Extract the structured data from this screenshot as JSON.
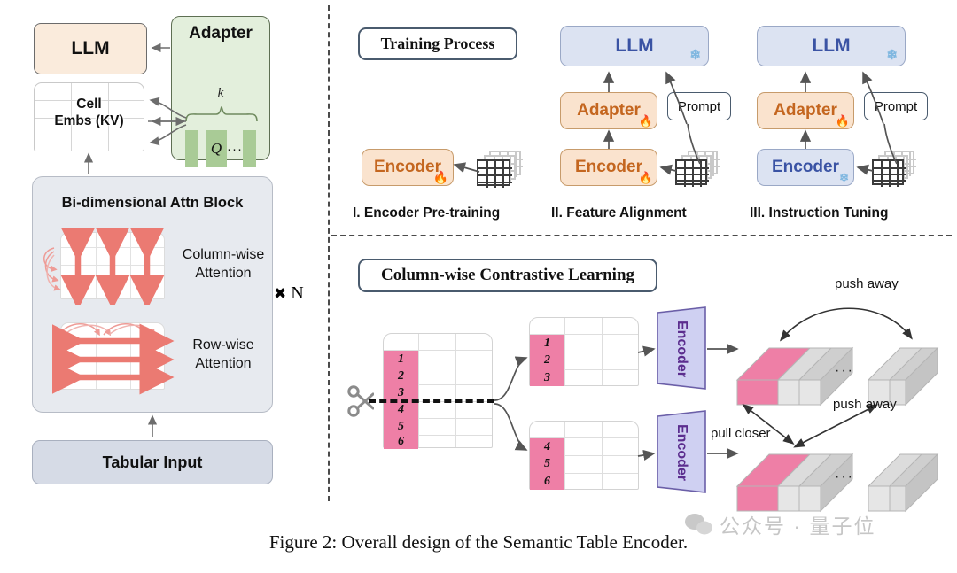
{
  "figure": {
    "caption": "Figure 2: Overall design of the Semantic Table Encoder.",
    "watermark": "公众号 · 量子位"
  },
  "left_panel": {
    "llm_label": "LLM",
    "adapter": {
      "title": "Adapter",
      "k_label": "k",
      "query_label": "Q",
      "ellipsis": "···"
    },
    "cell_embs_label": "Cell\nEmbs (KV)",
    "cell_embs_line1": "Cell",
    "cell_embs_line2": "Embs (KV)",
    "bidim_title": "Bi-dimensional Attn Block",
    "column_attention_label_line1": "Column-wise",
    "column_attention_label_line2": "Attention",
    "row_attention_label_line1": "Row-wise",
    "row_attention_label_line2": "Attention",
    "repeat_label": "N",
    "repeat_symbol": "✖",
    "tabular_input_label": "Tabular Input"
  },
  "training_process": {
    "section_title": "Training Process",
    "stages": [
      {
        "label": "I. Encoder Pre-training",
        "nodes": [
          {
            "name": "Encoder",
            "color": "orange",
            "state": "trainable",
            "state_icon": "fire-icon"
          }
        ],
        "has_prompt": false,
        "has_llm": false,
        "has_adapter": false
      },
      {
        "label": "II. Feature Alignment",
        "nodes": [
          {
            "name": "LLM",
            "color": "blue",
            "state": "frozen",
            "state_icon": "snowflake-icon"
          },
          {
            "name": "Adapter",
            "color": "orange",
            "state": "trainable",
            "state_icon": "fire-icon"
          },
          {
            "name": "Encoder",
            "color": "orange",
            "state": "trainable",
            "state_icon": "fire-icon"
          }
        ],
        "prompt_label": "Prompt",
        "has_prompt": true,
        "has_llm": true,
        "has_adapter": true
      },
      {
        "label": "III. Instruction Tuning",
        "nodes": [
          {
            "name": "LLM",
            "color": "blue",
            "state": "frozen",
            "state_icon": "snowflake-icon"
          },
          {
            "name": "Adapter",
            "color": "orange",
            "state": "trainable",
            "state_icon": "fire-icon"
          },
          {
            "name": "Encoder",
            "color": "blue",
            "state": "frozen",
            "state_icon": "snowflake-icon"
          }
        ],
        "prompt_label": "Prompt",
        "has_prompt": true,
        "has_llm": true,
        "has_adapter": true
      }
    ]
  },
  "contrastive": {
    "section_title": "Column-wise Contrastive Learning",
    "source_table_cells": [
      "1",
      "2",
      "3",
      "4",
      "5",
      "6"
    ],
    "split_top_cells": [
      "1",
      "2",
      "3"
    ],
    "split_bottom_cells": [
      "4",
      "5",
      "6"
    ],
    "encoder_label": "Encoder",
    "ellipsis": "· · ·",
    "relations": {
      "pull_closer": "pull closer",
      "push_away_top": "push away",
      "push_away_bottom": "push away"
    }
  },
  "colors": {
    "llm_left_bg": "#FAEBDC",
    "adapter_bg": "#E3EFDC",
    "adapter_block": "#A9CB96",
    "bidim_bg": "#E7EAEF",
    "tabular_bg": "#D6DBE6",
    "orange_node_bg": "#FAE3CE",
    "orange_node_text": "#C4661F",
    "blue_node_bg": "#DCE3F2",
    "blue_node_text": "#3A53A4",
    "attention_arrow": "#EB7A72",
    "pink_cell": "#EE7FA6",
    "encoder_trap_bg": "#CFD0F2",
    "encoder_trap_text": "#5B2D8E",
    "divider": "#4a4a4a"
  }
}
